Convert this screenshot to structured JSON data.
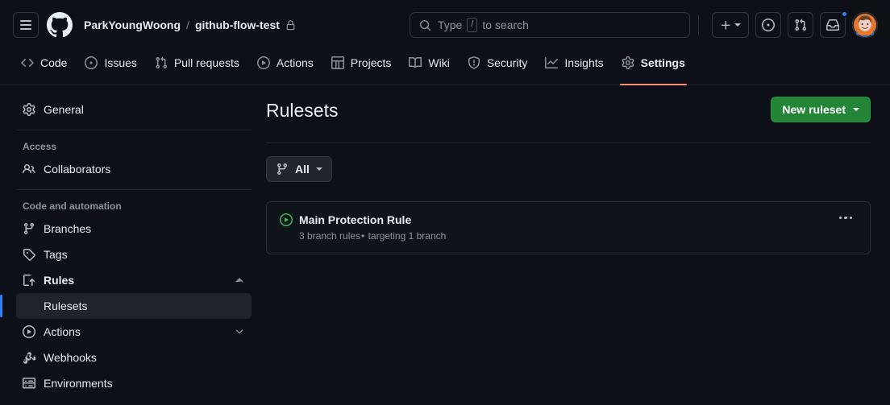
{
  "header": {
    "menu_icon": "hamburger-icon",
    "logo_icon": "github-logo-icon",
    "owner": "ParkYoungWoong",
    "separator": "/",
    "repo": "github-flow-test",
    "visibility_icon": "lock-icon",
    "search_placeholder": "Type",
    "search_key": "/",
    "search_suffix": "to search",
    "create_icon": "plus-icon",
    "issues_icon": "issue-opened-icon",
    "pull_requests_icon": "git-pull-request-icon",
    "inbox_icon": "inbox-icon",
    "avatar_label": "avatar"
  },
  "nav": {
    "tabs": [
      {
        "label": "Code",
        "icon": "code-icon",
        "active": false
      },
      {
        "label": "Issues",
        "icon": "issue-opened-icon",
        "active": false
      },
      {
        "label": "Pull requests",
        "icon": "git-pull-request-icon",
        "active": false
      },
      {
        "label": "Actions",
        "icon": "play-icon",
        "active": false
      },
      {
        "label": "Projects",
        "icon": "table-icon",
        "active": false
      },
      {
        "label": "Wiki",
        "icon": "book-icon",
        "active": false
      },
      {
        "label": "Security",
        "icon": "shield-icon",
        "active": false
      },
      {
        "label": "Insights",
        "icon": "graph-icon",
        "active": false
      },
      {
        "label": "Settings",
        "icon": "gear-icon",
        "active": true
      }
    ]
  },
  "sidebar": {
    "general": {
      "label": "General",
      "icon": "gear-icon"
    },
    "sections": [
      {
        "heading": "Access",
        "items": [
          {
            "label": "Collaborators",
            "icon": "people-icon"
          }
        ]
      },
      {
        "heading": "Code and automation",
        "items": [
          {
            "label": "Branches",
            "icon": "git-branch-icon"
          },
          {
            "label": "Tags",
            "icon": "tag-icon"
          },
          {
            "label": "Rules",
            "icon": "rules-icon",
            "expanded": true,
            "chevron": "chevron-up-icon",
            "children": [
              {
                "label": "Rulesets",
                "selected": true
              }
            ]
          },
          {
            "label": "Actions",
            "icon": "play-icon",
            "expanded": false,
            "chevron": "chevron-down-icon"
          },
          {
            "label": "Webhooks",
            "icon": "webhook-icon"
          },
          {
            "label": "Environments",
            "icon": "server-icon"
          }
        ]
      }
    ]
  },
  "main": {
    "title": "Rulesets",
    "new_ruleset_button": "New ruleset",
    "filter_button": "All",
    "filter_icon": "git-branch-icon",
    "rulesets": [
      {
        "name": "Main Protection Rule",
        "status_icon": "active-play-icon",
        "rules_count": "3 branch rules",
        "separator": "•",
        "target": " targeting 1 branch",
        "menu_icon": "kebab-horizontal-icon"
      }
    ]
  },
  "colors": {
    "background": "#0d1117",
    "accent_green": "#238636",
    "active_tab": "#fd8c73",
    "selected_blue": "#2f81f7",
    "status_green": "#3fb950"
  }
}
